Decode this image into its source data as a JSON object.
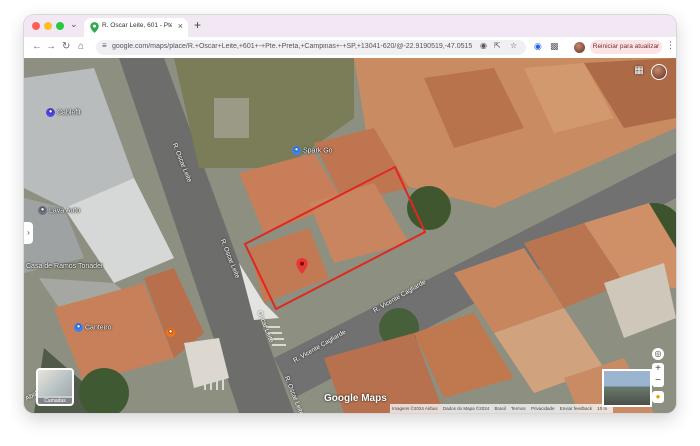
{
  "browser": {
    "tab_title": "R. Oscar Leite, 601 - Pte. Pr...",
    "new_tab": "+",
    "url": "google.com/maps/place/R.+Oscar+Leite,+601+-+Pte.+Preta,+Campinas+-+SP,+13041-620/@-22.9190519,-47.0515154,...",
    "update_button": "Reiniciar para atualizar",
    "icons": [
      "back-icon",
      "forward-icon",
      "reload-icon",
      "home-icon",
      "tune-icon",
      "location-icon",
      "share-icon",
      "bookmark-star-icon",
      "translate-icon",
      "extensions-icon",
      "menu-icon"
    ]
  },
  "map": {
    "places": [
      {
        "name": "Spark Go",
        "color": "#3b82f6"
      },
      {
        "name": "Cablefit",
        "color": "#4f46e5"
      },
      {
        "name": "Lava Auto",
        "color": "#6b7280"
      },
      {
        "name": "Casa de Ramos Tonadei",
        "color": "#6b7280"
      },
      {
        "name": "Canteiro",
        "color": "#3b82f6"
      }
    ],
    "unlabeled_poi_color": "#f97316",
    "streets": [
      "R. Oscar Leite",
      "R. Oscar Leite",
      "R. Vicente Cagliarde",
      "R. Vicente Cagliarde",
      "Oscar Leite",
      "R. Oscar Leite",
      "Abolição"
    ],
    "marker_color": "#e53935",
    "outline_color": "#e0281f",
    "layers_label": "Camadas",
    "logo": "Google Maps",
    "attribution": [
      "Imagens ©2024 Airbus",
      "Dados do Mapa ©2024",
      "Brasil",
      "Termos",
      "Privacidade",
      "Enviar feedback",
      "10 m"
    ]
  }
}
